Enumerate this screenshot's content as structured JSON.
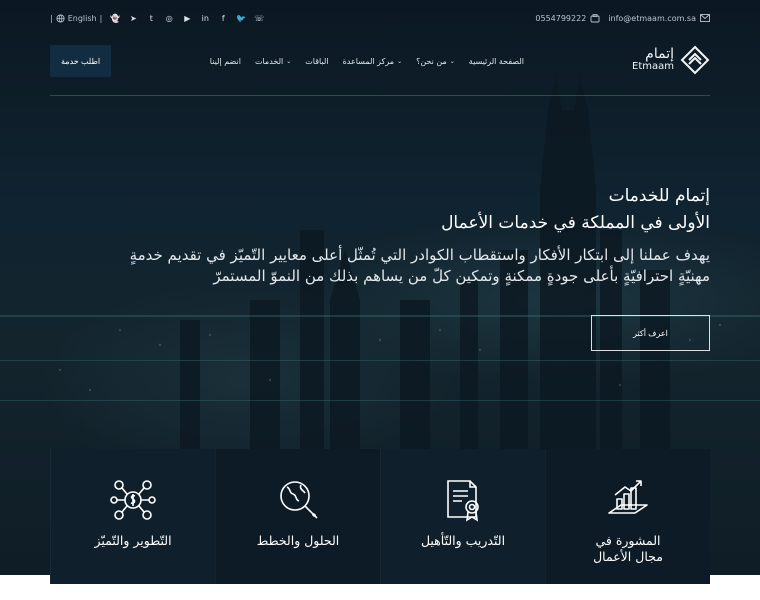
{
  "topbar": {
    "language": "English",
    "phone": "0554799222",
    "email": "info@etmaam.com.sa",
    "social_icons": [
      "whatsapp-icon",
      "twitter-icon",
      "facebook-icon",
      "linkedin-icon",
      "youtube-icon",
      "instagram-icon",
      "tumblr-icon",
      "telegram-icon",
      "snapchat-icon"
    ]
  },
  "nav": {
    "cta_label": "اطلب خدمة",
    "items": [
      {
        "label": "الصفحة الرئيسية",
        "dropdown": false
      },
      {
        "label": "من نحن؟",
        "dropdown": true
      },
      {
        "label": "مركز المساعدة",
        "dropdown": true
      },
      {
        "label": "الباقات",
        "dropdown": false
      },
      {
        "label": "الخدمات",
        "dropdown": true
      },
      {
        "label": "انضم إلينا",
        "dropdown": false
      }
    ],
    "logo_ar": "إتمام",
    "logo_en": "Etmaam"
  },
  "hero": {
    "title_line1": "إتمام للخدمات",
    "title_line2": "الأولى في المملكة في خدمات الأعمال",
    "description": "يهدف عملنا إلى ابتكار الأفكار واستقطاب الكوادر التي تُمثّل أعلى معايير التّميّز في تقديم خدمةٍ مهنيّةٍ احترافيّةٍ بأعلى جودةٍ ممكنةٍ وتمكين كلّ من يساهم بذلك من النموّ المستمرّ",
    "learn_more": "اعرف أكثر"
  },
  "services": [
    {
      "title": "المشورة في\nمجال الأعمال",
      "icon": "growth-chart-icon"
    },
    {
      "title": "التّدريب والتّأهيل",
      "icon": "certificate-icon"
    },
    {
      "title": "الحلول والخطط",
      "icon": "globe-search-icon"
    },
    {
      "title": "التّطوير والتّميّز",
      "icon": "money-network-icon"
    }
  ],
  "colors": {
    "background": "#0e1a24",
    "cta": "#122c42",
    "card": "#0c1b26",
    "text": "#ffffff"
  }
}
